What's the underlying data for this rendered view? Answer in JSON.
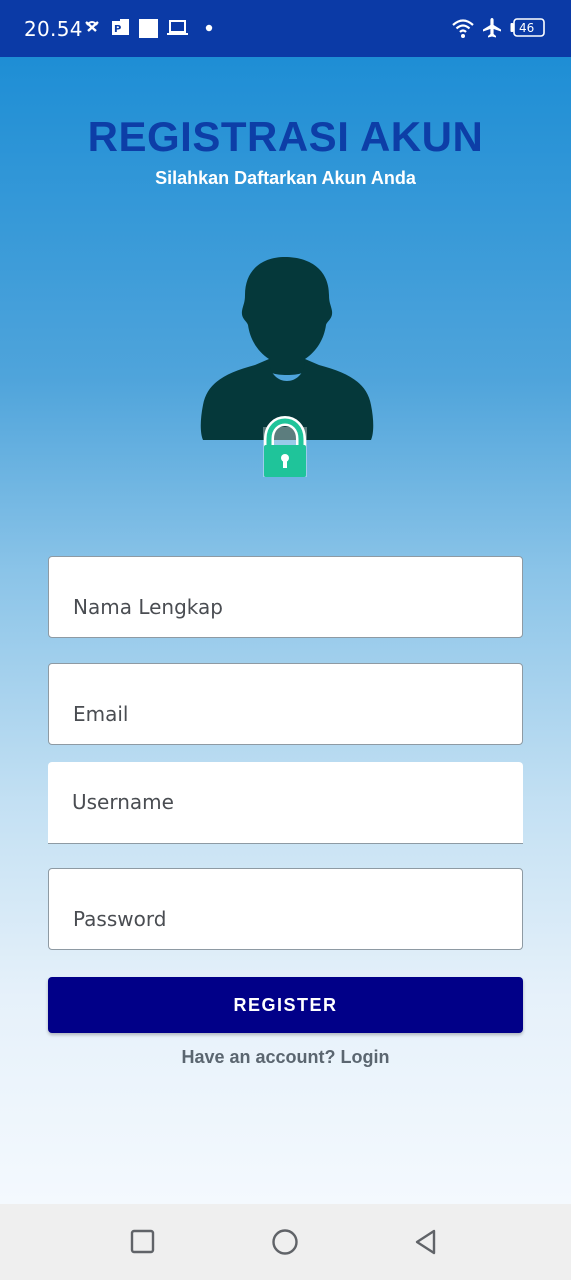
{
  "status_bar": {
    "time": "20.54",
    "battery_level": "46"
  },
  "header": {
    "title": "REGISTRASI AKUN",
    "subtitle": "Silahkan Daftarkan Akun Anda"
  },
  "form": {
    "full_name": {
      "placeholder": "Nama Lengkap",
      "value": ""
    },
    "email": {
      "placeholder": "Email",
      "value": ""
    },
    "username": {
      "placeholder": "Username",
      "value": ""
    },
    "password": {
      "placeholder": "Password",
      "value": ""
    },
    "register_label": "REGISTER",
    "login_link": "Have an account? Login"
  },
  "icons": {
    "avatar": "user-lock-icon",
    "nav_recent": "square-icon",
    "nav_home": "circle-icon",
    "nav_back": "triangle-back-icon"
  },
  "colors": {
    "status_bar": "#0b3aa6",
    "title": "#0d3ea7",
    "button": "#010088",
    "lock": "#1fc49a",
    "silhouette": "#05383a"
  }
}
